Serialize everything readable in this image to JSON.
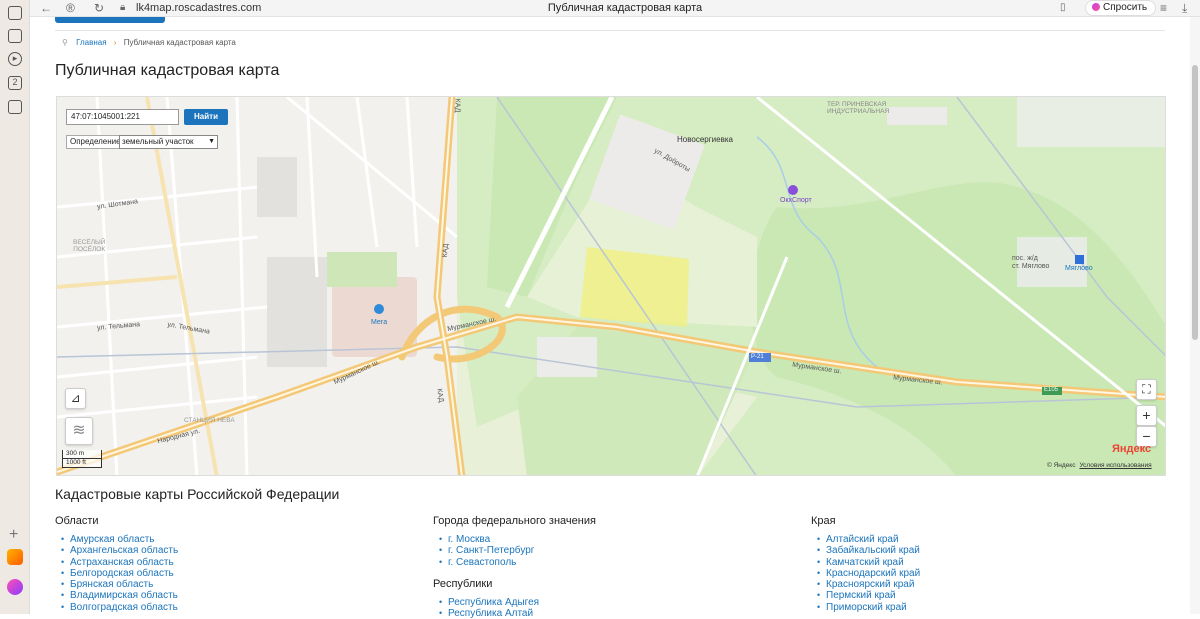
{
  "browser": {
    "url": "lk4map.roscadastres.com",
    "tab_title": "Публичная кадастровая карта",
    "ask_label": "Спросить",
    "sidebar_badge": "2"
  },
  "breadcrumb": {
    "home": "Главная",
    "current": "Публичная кадастровая карта"
  },
  "page_title": "Публичная кадастровая карта",
  "map": {
    "search_value": "47:07:1045001:221",
    "find_label": "Найти",
    "definition_label": "Определение",
    "definition_value": "земельный участок",
    "scale_top": "300 m",
    "scale_bottom": "1000 ft",
    "provider_logo": "Яндекс",
    "copyright": "© Яндекс",
    "terms_link": "Условия использования",
    "labels": {
      "novosergievka": "Новосергиевка",
      "okkhsport": "ОкхСпорт",
      "myaglovo_settlement": "пос. ж/д\nст. Мяглово",
      "myaglovo_station": "Мяглово",
      "mega": "Мега",
      "kad1": "КАД",
      "kad2": "КАД",
      "kad3": "КАД",
      "murmansk1": "Мурманское ш.",
      "murmansk2": "Мурманское ш.",
      "murmansk3": "Мурманское ш.",
      "murmansk4": "Мурманское ш.",
      "r21": "Р-21",
      "e105": "E105",
      "industrial": "ТЕР. ПРИНЕВСКАЯ\nИНДУСТРИАЛЬНАЯ",
      "vesely": "ВЕСЁЛЫЙ\nПОСЁЛОК",
      "neva": "СТАНЦИЯ НЕВА",
      "narodnaya": "Народная ул.",
      "telmana1": "ул. Тельмана",
      "telmana2": "ул. Тельмана",
      "shotmana": "ул. Шотмана",
      "dobrosti": "ул. Доброты"
    },
    "zoom_in": "+",
    "zoom_out": "−",
    "fullscreen": "⛶",
    "ruler": "⊿",
    "layers": "≋"
  },
  "federation_section": {
    "title": "Кадастровые карты Российской Федерации",
    "oblasti": {
      "heading": "Области",
      "items": [
        "Амурская область",
        "Архангельская область",
        "Астраханская область",
        "Белгородская область",
        "Брянская область",
        "Владимирская область",
        "Волгоградская область"
      ]
    },
    "federal_cities": {
      "heading": "Города федерального значения",
      "items": [
        "г. Москва",
        "г. Санкт-Петербург",
        "г. Севастополь"
      ]
    },
    "republics": {
      "heading": "Республики",
      "items": [
        "Республика Адыгея",
        "Республика Алтай"
      ]
    },
    "kraya": {
      "heading": "Края",
      "items": [
        "Алтайский край",
        "Забайкальский край",
        "Камчатский край",
        "Краснодарский край",
        "Красноярский край",
        "Пермский край",
        "Приморский край"
      ]
    }
  },
  "colors": {
    "link": "#1c75bc",
    "highlight_parcel": "#eef08a",
    "forest": "#c9e8b4",
    "road_major": "#f3c876"
  }
}
